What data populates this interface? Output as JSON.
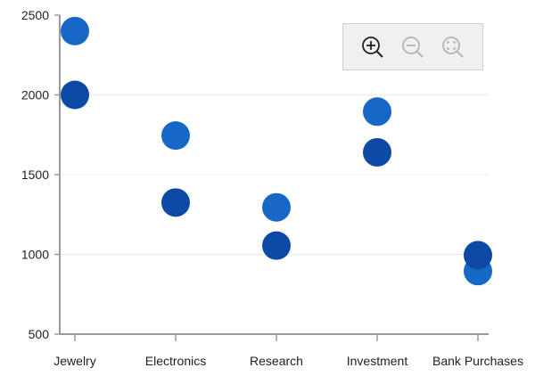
{
  "colors": {
    "series_a": "#0d4aa6",
    "series_b": "#1767c6",
    "axis": "#9a9a9a",
    "grid": "#ececec",
    "toolbar_active_icon": "#222222",
    "toolbar_inactive_icon": "#b5b5b5"
  },
  "toolbar": {
    "icons": [
      "zoom-in-icon",
      "zoom-out-icon",
      "reset-zoom-icon"
    ]
  },
  "chart_data": {
    "type": "scatter",
    "categories": [
      "Jewelry",
      "Electronics",
      "Research",
      "Investment",
      "Bank Purchases"
    ],
    "yticks": [
      "500",
      "1000",
      "1500",
      "2000",
      "2500"
    ],
    "ylim": [
      500,
      2500
    ],
    "grid": true,
    "legend": "none",
    "series": [
      {
        "values": [
          2000,
          1325,
          1055,
          1640,
          995
        ]
      },
      {
        "values": [
          2400,
          1745,
          1295,
          1895,
          895
        ]
      }
    ]
  }
}
